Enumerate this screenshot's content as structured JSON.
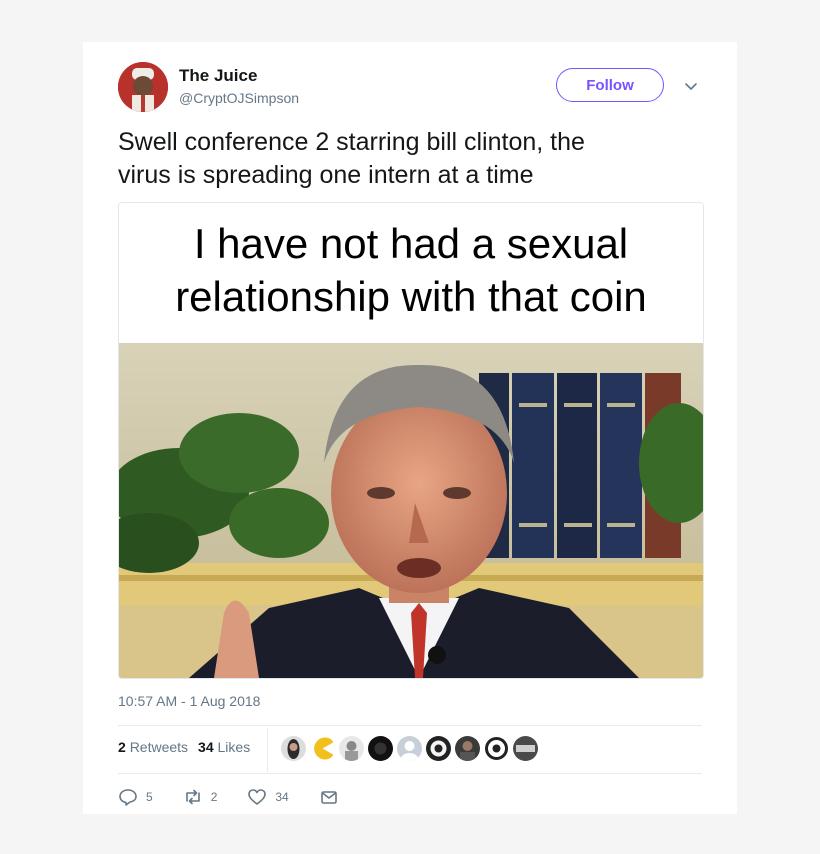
{
  "tweet": {
    "author_name": "The Juice",
    "author_handle": "@CryptOJSimpson",
    "follow_label": "Follow",
    "text_line1": "Swell conference 2  starring bill clinton, the",
    "text_line2": "virus is spreading one intern at a time",
    "media": {
      "caption_line1": "I have not had a sexual",
      "caption_line2": "relationship with that coin"
    },
    "timestamp": "10:57 AM - 1 Aug 2018",
    "retweets_count": "2",
    "retweets_label": "Retweets",
    "likes_count": "34",
    "likes_label": "Likes",
    "actions": {
      "reply_count": "5",
      "retweet_count": "2",
      "like_count": "34"
    }
  },
  "colors": {
    "accent": "#7b52ff",
    "secondary_text": "#657786",
    "divider": "#e6ecf0"
  }
}
